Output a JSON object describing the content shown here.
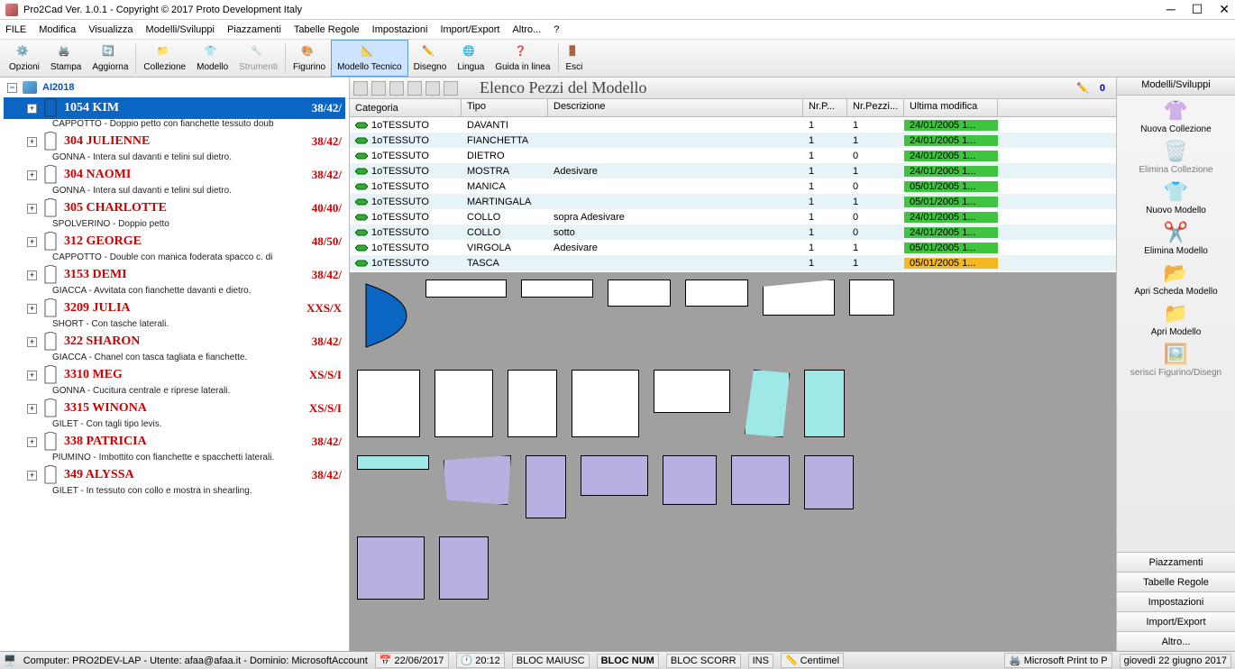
{
  "title": "Pro2Cad Ver. 1.0.1 - Copyright © 2017 Proto Development Italy",
  "menu": [
    "FILE",
    "Modifica",
    "Visualizza",
    "Modelli/Sviluppi",
    "Piazzamenti",
    "Tabelle Regole",
    "Impostazioni",
    "Import/Export",
    "Altro...",
    "?"
  ],
  "toolbar": [
    {
      "label": "Opzioni"
    },
    {
      "label": "Stampa"
    },
    {
      "label": "Aggiorna"
    },
    {
      "label": "Collezione"
    },
    {
      "label": "Modello"
    },
    {
      "label": "Strumenti",
      "disabled": true
    },
    {
      "label": "Figurino"
    },
    {
      "label": "Modello Tecnico",
      "active": true
    },
    {
      "label": "Disegno"
    },
    {
      "label": "Lingua"
    },
    {
      "label": "Guida in linea"
    },
    {
      "label": "Esci"
    }
  ],
  "collection": "AI2018",
  "models": [
    {
      "name": "1054 KIM",
      "sizes": "38/42/",
      "desc": "CAPPOTTO - Doppio petto con fianchette tessuto doub",
      "selected": true
    },
    {
      "name": "304 JULIENNE",
      "sizes": "38/42/",
      "desc": "GONNA - Intera sul davanti e telini sul dietro."
    },
    {
      "name": "304 NAOMI",
      "sizes": "38/42/",
      "desc": "GONNA - Intera sul davanti e telini sul dietro."
    },
    {
      "name": "305 CHARLOTTE",
      "sizes": "40/40/",
      "desc": "SPOLVERINO - Doppio petto"
    },
    {
      "name": "312 GEORGE",
      "sizes": "48/50/",
      "desc": "CAPPOTTO - Double con manica foderata spacco c. di"
    },
    {
      "name": "3153 DEMI",
      "sizes": "38/42/",
      "desc": "GIACCA - Avvitata con fianchette davanti e dietro."
    },
    {
      "name": "3209 JULIA",
      "sizes": "XXS/X",
      "desc": "SHORT - Con tasche laterali."
    },
    {
      "name": "322 SHARON",
      "sizes": "38/42/",
      "desc": "GIACCA - Chanel con tasca tagliata e fianchette."
    },
    {
      "name": "3310 MEG",
      "sizes": "XS/S/I",
      "desc": "GONNA - Cucitura centrale e riprese laterali."
    },
    {
      "name": "3315 WINONA",
      "sizes": "XS/S/I",
      "desc": "GILET - Con tagli tipo levis."
    },
    {
      "name": "338 PATRICIA",
      "sizes": "38/42/",
      "desc": "PIUMINO - Imbottito con fianchette e spacchetti laterali."
    },
    {
      "name": "349 ALYSSA",
      "sizes": "38/42/",
      "desc": "GILET - In tessuto con collo e mostra in shearling."
    }
  ],
  "centerTitle": "Elenco Pezzi del Modello",
  "countBadge": "0",
  "gridHeaders": {
    "cat": "Categoria",
    "tipo": "Tipo",
    "desc": "Descrizione",
    "np": "Nr.P...",
    "npi": "Nr.Pezzi...",
    "mod": "Ultima modifica"
  },
  "rows": [
    {
      "cat": "1oTESSUTO",
      "tipo": "DAVANTI",
      "desc": "",
      "np": "1",
      "npi": "1",
      "mod": "24/01/2005 1...",
      "dc": "green"
    },
    {
      "cat": "1oTESSUTO",
      "tipo": "FIANCHETTA",
      "desc": "",
      "np": "1",
      "npi": "1",
      "mod": "24/01/2005 1...",
      "dc": "green"
    },
    {
      "cat": "1oTESSUTO",
      "tipo": "DIETRO",
      "desc": "",
      "np": "1",
      "npi": "0",
      "mod": "24/01/2005 1...",
      "dc": "green"
    },
    {
      "cat": "1oTESSUTO",
      "tipo": "MOSTRA",
      "desc": "Adesivare",
      "np": "1",
      "npi": "1",
      "mod": "24/01/2005 1...",
      "dc": "green"
    },
    {
      "cat": "1oTESSUTO",
      "tipo": "MANICA",
      "desc": "",
      "np": "1",
      "npi": "0",
      "mod": "05/01/2005 1...",
      "dc": "green"
    },
    {
      "cat": "1oTESSUTO",
      "tipo": "MARTINGALA",
      "desc": "",
      "np": "1",
      "npi": "1",
      "mod": "05/01/2005 1...",
      "dc": "green"
    },
    {
      "cat": "1oTESSUTO",
      "tipo": "COLLO",
      "desc": "sopra Adesivare",
      "np": "1",
      "npi": "0",
      "mod": "24/01/2005 1...",
      "dc": "green"
    },
    {
      "cat": "1oTESSUTO",
      "tipo": "COLLO",
      "desc": "sotto",
      "np": "1",
      "npi": "0",
      "mod": "24/01/2005 1...",
      "dc": "green"
    },
    {
      "cat": "1oTESSUTO",
      "tipo": "VIRGOLA",
      "desc": "Adesivare",
      "np": "1",
      "npi": "1",
      "mod": "05/01/2005 1...",
      "dc": "green"
    },
    {
      "cat": "1oTESSUTO",
      "tipo": "TASCA",
      "desc": "",
      "np": "1",
      "npi": "1",
      "mod": "05/01/2005 1...",
      "dc": "orange"
    }
  ],
  "rightTitle": "Modelli/Sviluppi",
  "rightItems": [
    {
      "label": "Nuova Collezione"
    },
    {
      "label": "Elimina Collezione",
      "disabled": true
    },
    {
      "label": "Nuovo Modello"
    },
    {
      "label": "Elimina Modello"
    },
    {
      "label": "Apri Scheda Modello"
    },
    {
      "label": "Apri Modello"
    },
    {
      "label": "serisci Figurino/Disegn",
      "disabled": true
    }
  ],
  "rightButtons": [
    "Piazzamenti",
    "Tabelle Regole",
    "Impostazioni",
    "Import/Export",
    "Altro..."
  ],
  "status": {
    "computer": "Computer: PRO2DEV-LAP - Utente: afaa@afaa.it - Dominio: MicrosoftAccount",
    "date": "22/06/2017",
    "time": "20:12",
    "caps": "BLOC MAIUSC",
    "num": "BLOC NUM",
    "scroll": "BLOC SCORR",
    "ins": "INS",
    "unit": "Centimel",
    "printer": "Microsoft Print to P",
    "longdate": "giovedì 22 giugno 2017"
  }
}
